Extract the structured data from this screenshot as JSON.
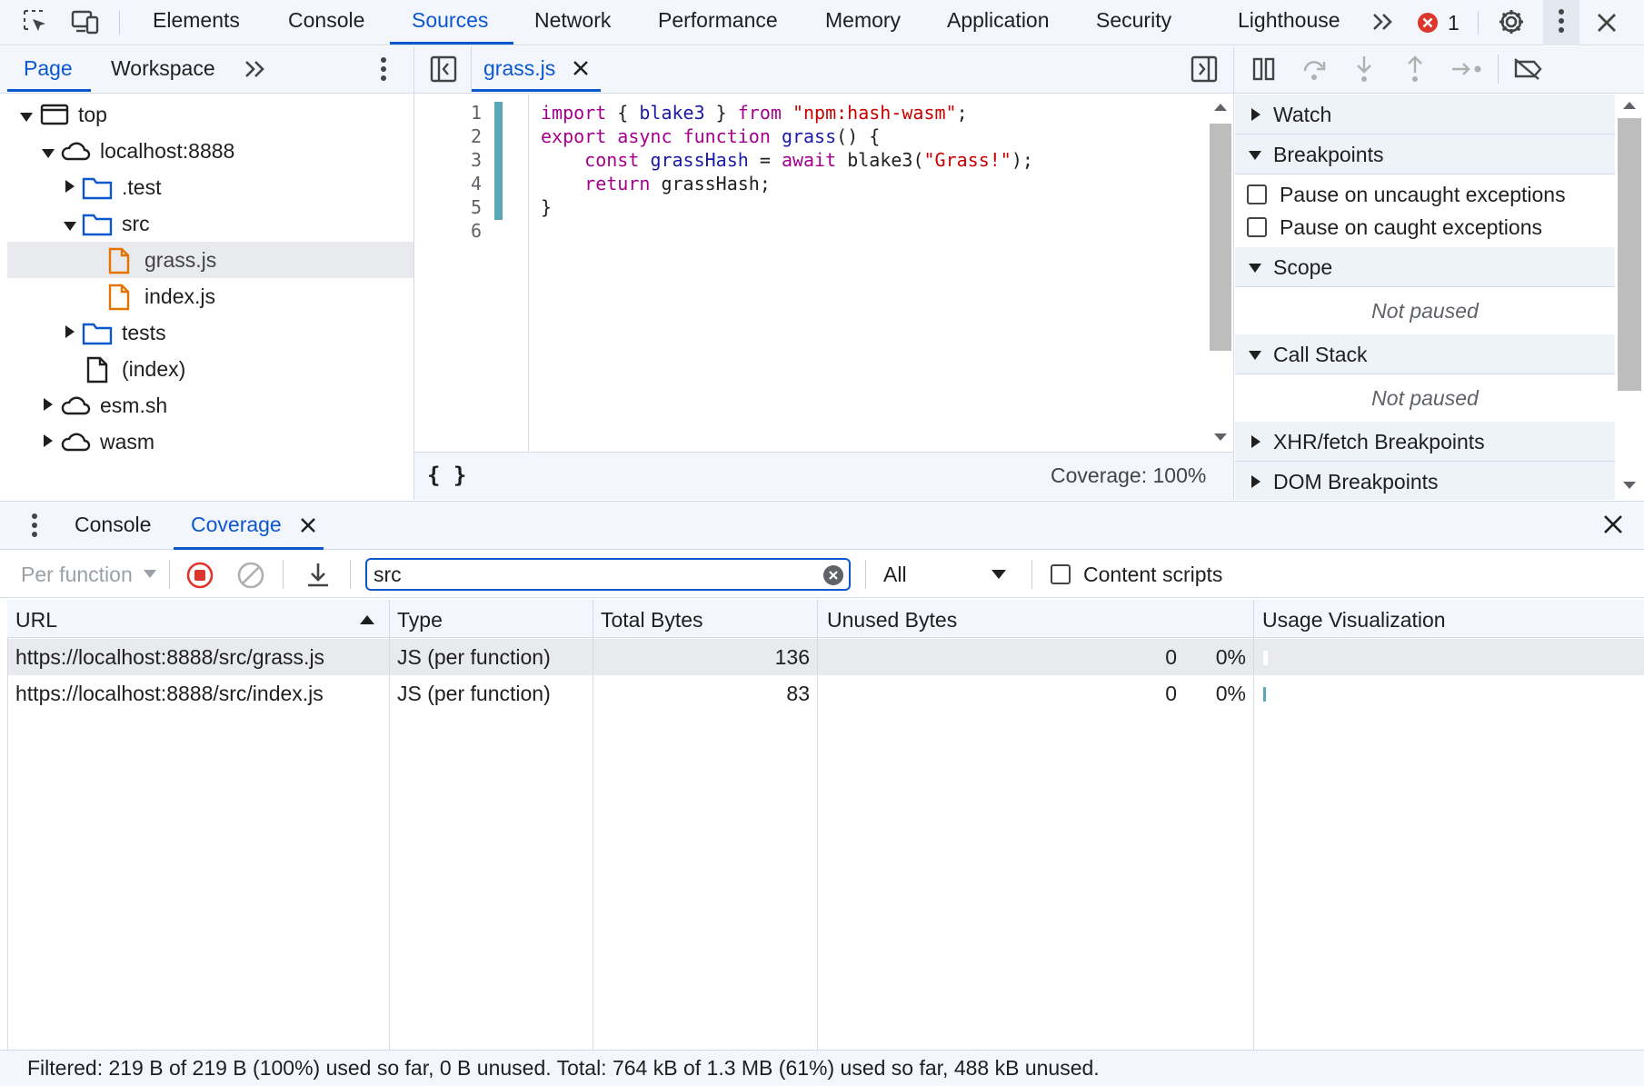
{
  "toolbar": {
    "tabs": [
      "Elements",
      "Console",
      "Sources",
      "Network",
      "Performance",
      "Memory",
      "Application",
      "Security",
      "Lighthouse"
    ],
    "active_tab": "Sources",
    "error_count": "1"
  },
  "navigator": {
    "tabs": [
      "Page",
      "Workspace"
    ],
    "active_tab": "Page",
    "tree": {
      "top": "top",
      "localhost": "localhost:8888",
      "test": ".test",
      "src": "src",
      "grass": "grass.js",
      "index": "index.js",
      "tests": "tests",
      "index_doc": "(index)",
      "esm": "esm.sh",
      "wasm": "wasm"
    }
  },
  "editor": {
    "file_tab": "grass.js",
    "line_numbers": [
      "1",
      "2",
      "3",
      "4",
      "5",
      "6"
    ],
    "code": {
      "l1_import": "import",
      "l1_a": " { ",
      "l1_blake": "blake3",
      "l1_b": " } ",
      "l1_from": "from",
      "l1_sp": " ",
      "l1_str": "\"npm:hash-wasm\"",
      "l1_end": ";",
      "l2_export": "export",
      "l2_sp1": " ",
      "l2_async": "async",
      "l2_sp2": " ",
      "l2_function": "function",
      "l2_sp3": " ",
      "l2_name": "grass",
      "l2_end": "() {",
      "l3_indent": "    ",
      "l3_const": "const",
      "l3_sp": " ",
      "l3_var": "grassHash",
      "l3_eq": " = ",
      "l3_await": "await",
      "l3_call": " blake3(",
      "l3_str": "\"Grass!\"",
      "l3_end": ");",
      "l4_indent": "    ",
      "l4_return": "return",
      "l4_rest": " grassHash;",
      "l5": "}"
    },
    "format_icon": "{ }",
    "coverage": "Coverage: 100%"
  },
  "debugger": {
    "sections": {
      "watch": "Watch",
      "breakpoints": "Breakpoints",
      "pause_uncaught": "Pause on uncaught exceptions",
      "pause_caught": "Pause on caught exceptions",
      "scope": "Scope",
      "scope_status": "Not paused",
      "call_stack": "Call Stack",
      "call_stack_status": "Not paused",
      "xhr": "XHR/fetch Breakpoints",
      "dom": "DOM Breakpoints"
    }
  },
  "drawer": {
    "tabs": [
      "Console",
      "Coverage"
    ],
    "active_tab": "Coverage",
    "toolbar": {
      "mode": "Per function",
      "filter_value": "src",
      "type_select": "All",
      "content_scripts": "Content scripts"
    },
    "columns": [
      "URL",
      "Type",
      "Total Bytes",
      "Unused Bytes",
      "Usage Visualization"
    ],
    "rows": [
      {
        "url": "https://localhost:8888/src/grass.js",
        "type": "JS (per function)",
        "total": "136",
        "unused": "0",
        "pct": "0%",
        "used_fraction": 1.0
      },
      {
        "url": "https://localhost:8888/src/index.js",
        "type": "JS (per function)",
        "total": "83",
        "unused": "0",
        "pct": "0%",
        "used_fraction": 1.0
      }
    ],
    "status": "Filtered: 219 B of 219 B (100%) used so far, 0 B unused. Total: 764 kB of 1.3 MB (61%) used so far, 488 kB unused."
  },
  "colors": {
    "accent": "#0b57d0",
    "coverage_bar": "#5aa8b5",
    "error": "#dc362e",
    "file_icon": "#e37400",
    "folder_icon": "#0b57d0"
  }
}
